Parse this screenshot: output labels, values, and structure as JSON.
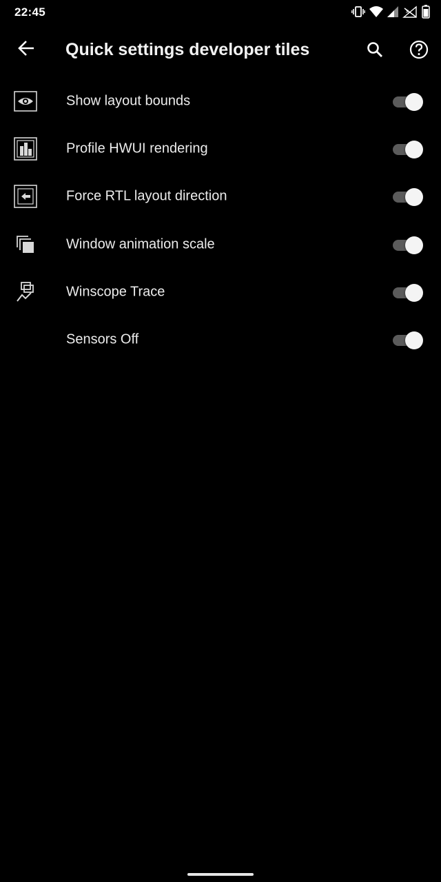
{
  "status_bar": {
    "time": "22:45",
    "icons": [
      "vibrate-icon",
      "wifi-icon",
      "signal-icon",
      "no-signal-icon",
      "battery-icon"
    ]
  },
  "app_bar": {
    "title": "Quick settings developer tiles",
    "back_icon": "arrow-back-icon",
    "search_icon": "search-icon",
    "help_icon": "help-icon"
  },
  "tiles": [
    {
      "label": "Show layout bounds",
      "icon": "layout-bounds-icon",
      "enabled": true
    },
    {
      "label": "Profile HWUI rendering",
      "icon": "hwui-profile-icon",
      "enabled": true
    },
    {
      "label": "Force RTL layout direction",
      "icon": "rtl-direction-icon",
      "enabled": true
    },
    {
      "label": "Window animation scale",
      "icon": "window-animation-icon",
      "enabled": true
    },
    {
      "label": "Winscope Trace",
      "icon": "winscope-trace-icon",
      "enabled": true
    },
    {
      "label": "Sensors Off",
      "icon": "",
      "enabled": true
    }
  ],
  "colors": {
    "background": "#000000",
    "text": "#ececec",
    "toggle_track_on": "#5b5b5b",
    "toggle_thumb_on": "#f4f4f4"
  }
}
